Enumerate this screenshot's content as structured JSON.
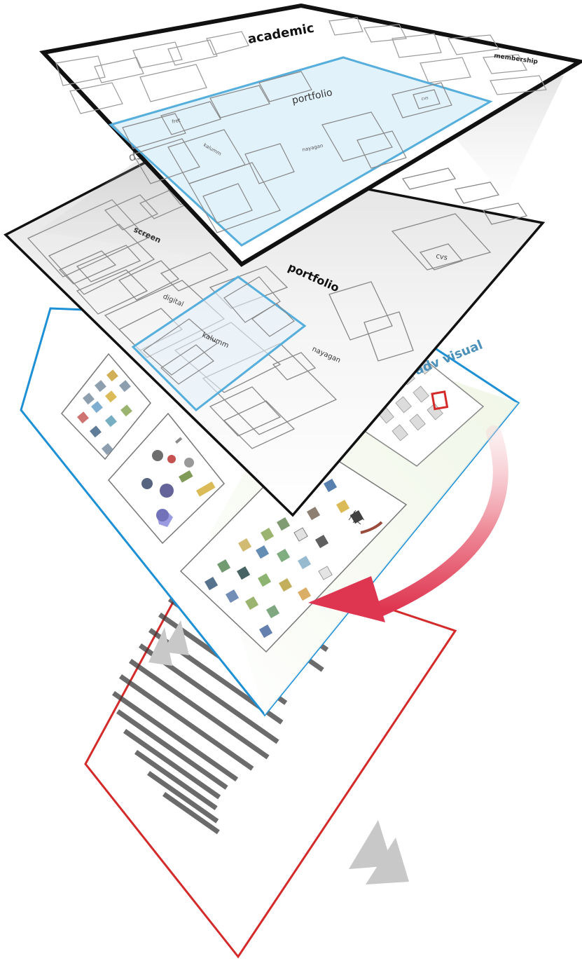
{
  "labels": {
    "academic": "academic",
    "membership": "membership",
    "portfolio_top": "portfolio",
    "fret": "fret",
    "kalumm_top": "kalumm",
    "nayagan_top": "nayagan",
    "cvs_top": "cvs",
    "d3": "d3",
    "screen": "screen",
    "portfolio_mid": "portfolio",
    "digital": "digital",
    "cvs_mid": "cvs",
    "kalumm_mid": "kalumm",
    "nayagan_mid": "nayagan",
    "adv_visual": "adv visual",
    "icons": "icons"
  },
  "colors": {
    "top_border": "#111111",
    "mid_border": "#111111",
    "blue_layer_border": "#1e90d6",
    "blue_highlight": "#55aedc",
    "blue_fill": "#d8eefa",
    "red_page_border": "#d42a2a",
    "arrow": "#e0465a",
    "label_blue": "#4a90b8"
  },
  "icons": {
    "transition_arrow": "curved-arrow-icon",
    "flip_up": "double-triangle-up-icon",
    "flip_down": "double-triangle-down-icon"
  }
}
